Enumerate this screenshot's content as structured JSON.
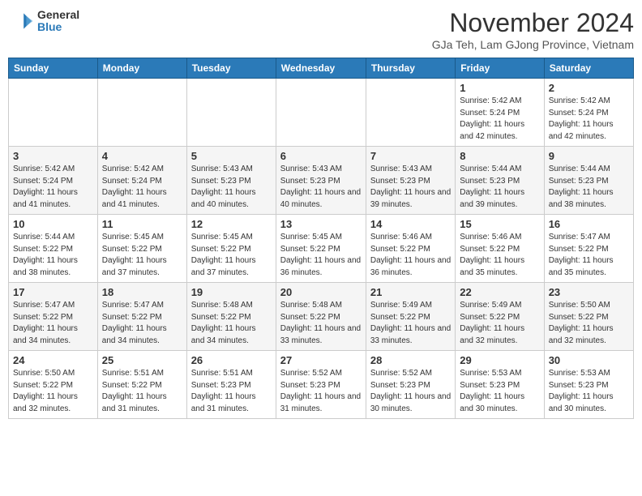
{
  "header": {
    "logo_general": "General",
    "logo_blue": "Blue",
    "month_title": "November 2024",
    "location": "GJa Teh, Lam GJong Province, Vietnam"
  },
  "weekdays": [
    "Sunday",
    "Monday",
    "Tuesday",
    "Wednesday",
    "Thursday",
    "Friday",
    "Saturday"
  ],
  "weeks": [
    [
      null,
      null,
      null,
      null,
      null,
      {
        "day": 1,
        "sunrise": "5:42 AM",
        "sunset": "5:24 PM",
        "daylight": "11 hours and 42 minutes."
      },
      {
        "day": 2,
        "sunrise": "5:42 AM",
        "sunset": "5:24 PM",
        "daylight": "11 hours and 42 minutes."
      }
    ],
    [
      {
        "day": 3,
        "sunrise": "5:42 AM",
        "sunset": "5:24 PM",
        "daylight": "11 hours and 41 minutes."
      },
      {
        "day": 4,
        "sunrise": "5:42 AM",
        "sunset": "5:24 PM",
        "daylight": "11 hours and 41 minutes."
      },
      {
        "day": 5,
        "sunrise": "5:43 AM",
        "sunset": "5:23 PM",
        "daylight": "11 hours and 40 minutes."
      },
      {
        "day": 6,
        "sunrise": "5:43 AM",
        "sunset": "5:23 PM",
        "daylight": "11 hours and 40 minutes."
      },
      {
        "day": 7,
        "sunrise": "5:43 AM",
        "sunset": "5:23 PM",
        "daylight": "11 hours and 39 minutes."
      },
      {
        "day": 8,
        "sunrise": "5:44 AM",
        "sunset": "5:23 PM",
        "daylight": "11 hours and 39 minutes."
      },
      {
        "day": 9,
        "sunrise": "5:44 AM",
        "sunset": "5:23 PM",
        "daylight": "11 hours and 38 minutes."
      }
    ],
    [
      {
        "day": 10,
        "sunrise": "5:44 AM",
        "sunset": "5:22 PM",
        "daylight": "11 hours and 38 minutes."
      },
      {
        "day": 11,
        "sunrise": "5:45 AM",
        "sunset": "5:22 PM",
        "daylight": "11 hours and 37 minutes."
      },
      {
        "day": 12,
        "sunrise": "5:45 AM",
        "sunset": "5:22 PM",
        "daylight": "11 hours and 37 minutes."
      },
      {
        "day": 13,
        "sunrise": "5:45 AM",
        "sunset": "5:22 PM",
        "daylight": "11 hours and 36 minutes."
      },
      {
        "day": 14,
        "sunrise": "5:46 AM",
        "sunset": "5:22 PM",
        "daylight": "11 hours and 36 minutes."
      },
      {
        "day": 15,
        "sunrise": "5:46 AM",
        "sunset": "5:22 PM",
        "daylight": "11 hours and 35 minutes."
      },
      {
        "day": 16,
        "sunrise": "5:47 AM",
        "sunset": "5:22 PM",
        "daylight": "11 hours and 35 minutes."
      }
    ],
    [
      {
        "day": 17,
        "sunrise": "5:47 AM",
        "sunset": "5:22 PM",
        "daylight": "11 hours and 34 minutes."
      },
      {
        "day": 18,
        "sunrise": "5:47 AM",
        "sunset": "5:22 PM",
        "daylight": "11 hours and 34 minutes."
      },
      {
        "day": 19,
        "sunrise": "5:48 AM",
        "sunset": "5:22 PM",
        "daylight": "11 hours and 34 minutes."
      },
      {
        "day": 20,
        "sunrise": "5:48 AM",
        "sunset": "5:22 PM",
        "daylight": "11 hours and 33 minutes."
      },
      {
        "day": 21,
        "sunrise": "5:49 AM",
        "sunset": "5:22 PM",
        "daylight": "11 hours and 33 minutes."
      },
      {
        "day": 22,
        "sunrise": "5:49 AM",
        "sunset": "5:22 PM",
        "daylight": "11 hours and 32 minutes."
      },
      {
        "day": 23,
        "sunrise": "5:50 AM",
        "sunset": "5:22 PM",
        "daylight": "11 hours and 32 minutes."
      }
    ],
    [
      {
        "day": 24,
        "sunrise": "5:50 AM",
        "sunset": "5:22 PM",
        "daylight": "11 hours and 32 minutes."
      },
      {
        "day": 25,
        "sunrise": "5:51 AM",
        "sunset": "5:22 PM",
        "daylight": "11 hours and 31 minutes."
      },
      {
        "day": 26,
        "sunrise": "5:51 AM",
        "sunset": "5:23 PM",
        "daylight": "11 hours and 31 minutes."
      },
      {
        "day": 27,
        "sunrise": "5:52 AM",
        "sunset": "5:23 PM",
        "daylight": "11 hours and 31 minutes."
      },
      {
        "day": 28,
        "sunrise": "5:52 AM",
        "sunset": "5:23 PM",
        "daylight": "11 hours and 30 minutes."
      },
      {
        "day": 29,
        "sunrise": "5:53 AM",
        "sunset": "5:23 PM",
        "daylight": "11 hours and 30 minutes."
      },
      {
        "day": 30,
        "sunrise": "5:53 AM",
        "sunset": "5:23 PM",
        "daylight": "11 hours and 30 minutes."
      }
    ]
  ]
}
